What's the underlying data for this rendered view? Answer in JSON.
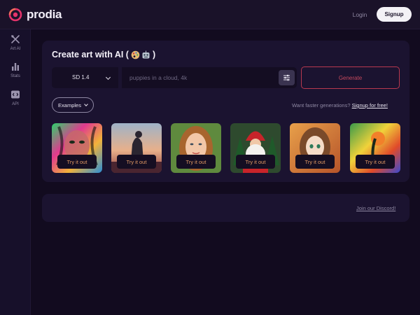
{
  "brand": {
    "name": "prodia",
    "accent": "#e5336b"
  },
  "header": {
    "login_label": "Login",
    "signup_label": "Signup"
  },
  "sidebar": {
    "items": [
      {
        "label": "Art AI",
        "icon": "brush-icon"
      },
      {
        "label": "Stats",
        "icon": "bar-chart-icon"
      },
      {
        "label": "API",
        "icon": "code-icon"
      }
    ]
  },
  "main": {
    "title": "Create art with AI (",
    "title_close": ")",
    "title_emojis": [
      "palette-emoji",
      "robot-emoji"
    ],
    "model": {
      "selected": "SD 1.4"
    },
    "prompt": {
      "placeholder": "puppies in a cloud, 4k",
      "value": ""
    },
    "generate_label": "Generate",
    "examples_label": "Examples",
    "faster_text": "Want faster generations?",
    "faster_link": "Signup for free!",
    "examples": [
      {
        "name": "example-painted-face",
        "button": "Try it out"
      },
      {
        "name": "example-knight-statue",
        "button": "Try it out"
      },
      {
        "name": "example-portrait-woman",
        "button": "Try it out"
      },
      {
        "name": "example-santa",
        "button": "Try it out"
      },
      {
        "name": "example-anime-girl",
        "button": "Try it out"
      },
      {
        "name": "example-colorful-landscape",
        "button": "Try it out"
      }
    ]
  },
  "footer_card": {
    "discord_label": "Join our Discord!"
  },
  "colors": {
    "background": "#120b1f",
    "card": "#1b1330",
    "generate_border": "#b8384f",
    "try_text": "#e39a64"
  }
}
